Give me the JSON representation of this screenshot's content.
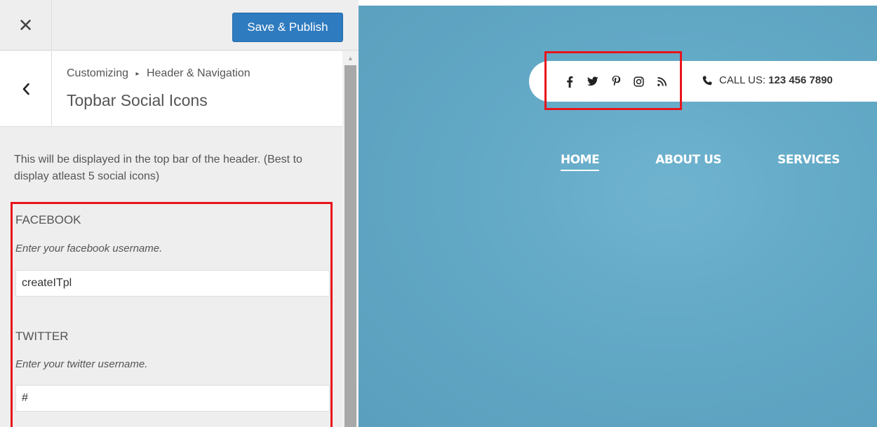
{
  "customizer": {
    "close_glyph": "✕",
    "publish_label": "Save & Publish",
    "breadcrumb": {
      "parent": "Customizing",
      "separator": "▸",
      "section": "Header & Navigation"
    },
    "section_title": "Topbar Social Icons",
    "description": "This will be displayed in the top bar of the header. (Best to display atleast 5 social icons)",
    "fields": [
      {
        "label": "FACEBOOK",
        "help": "Enter your facebook username.",
        "value": "createITpl"
      },
      {
        "label": "TWITTER",
        "help": "Enter your twitter username.",
        "value": "#"
      }
    ]
  },
  "preview": {
    "social_icons": [
      "facebook-icon",
      "twitter-icon",
      "pinterest-icon",
      "instagram-icon",
      "rss-icon"
    ],
    "call_label": "CALL US:",
    "call_number": "123 456 7890",
    "nav": [
      {
        "label": "HOME",
        "active": true
      },
      {
        "label": "ABOUT US",
        "active": false
      },
      {
        "label": "SERVICES",
        "active": false
      }
    ]
  },
  "colors": {
    "accent_blue": "#2f7bbf",
    "highlight_red": "#e8141b",
    "preview_background": "#62a9c6",
    "panel_background": "#eeeeee"
  }
}
